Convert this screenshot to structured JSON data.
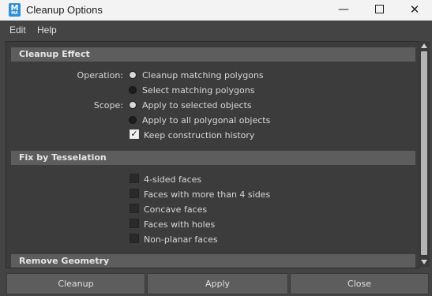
{
  "window": {
    "title": "Cleanup Options",
    "app_icon_letter": "M",
    "app_icon_sub": "MA",
    "controls": [
      "minimize-icon",
      "maximize-icon",
      "close-icon"
    ]
  },
  "menu": {
    "items": [
      "Edit",
      "Help"
    ]
  },
  "cleanup_effect": {
    "header": "Cleanup Effect",
    "operation_label": "Operation:",
    "operation_options": [
      "Cleanup matching polygons",
      "Select matching polygons"
    ],
    "operation_selected": "Cleanup matching polygons",
    "scope_label": "Scope:",
    "scope_options": [
      "Apply to selected objects",
      "Apply to all polygonal objects"
    ],
    "scope_selected": "Apply to selected objects",
    "keep_history_label": "Keep construction history",
    "keep_history_checked": true
  },
  "fix_by_tesselation": {
    "header": "Fix by Tesselation",
    "options": [
      {
        "label": "4-sided faces",
        "checked": false
      },
      {
        "label": "Faces with more than 4 sides",
        "checked": false
      },
      {
        "label": "Concave faces",
        "checked": false
      },
      {
        "label": "Faces with holes",
        "checked": false
      },
      {
        "label": "Non-planar faces",
        "checked": false
      }
    ]
  },
  "remove_geometry": {
    "header": "Remove Geometry"
  },
  "buttons": {
    "cleanup": "Cleanup",
    "apply": "Apply",
    "close": "Close"
  },
  "colors": {
    "background": "#444444",
    "panel": "#3c3c3c",
    "section_header": "#5d5d5d",
    "button": "#5d5d5d",
    "title_bar": "#f3f3f3",
    "app_icon": "#2d8fd6"
  }
}
